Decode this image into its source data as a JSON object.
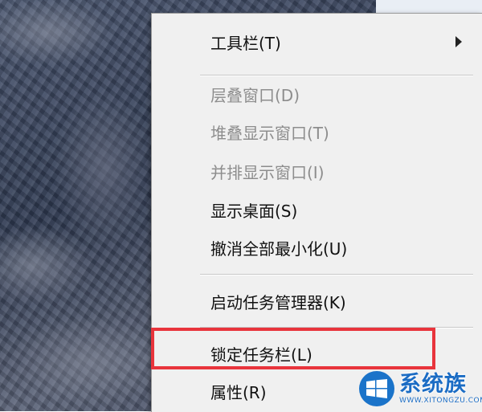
{
  "menu": {
    "items": [
      {
        "label": "工具栏(T)",
        "enabled": true,
        "submenu": true
      },
      {
        "label": "层叠窗口(D)",
        "enabled": false
      },
      {
        "label": "堆叠显示窗口(T)",
        "enabled": false
      },
      {
        "label": "并排显示窗口(I)",
        "enabled": false
      },
      {
        "label": "显示桌面(S)",
        "enabled": true
      },
      {
        "label": "撤消全部最小化(U)",
        "enabled": true
      },
      {
        "label": "启动任务管理器(K)",
        "enabled": true
      },
      {
        "label": "锁定任务栏(L)",
        "enabled": true,
        "highlighted": true
      },
      {
        "label": "属性(R)",
        "enabled": true
      }
    ]
  },
  "watermark": {
    "title": "系统族",
    "subtitle": "WWW.XITONGZU.COM"
  },
  "colors": {
    "menu_background": "#f0f0f0",
    "disabled_text": "#8d8d8d",
    "highlight_border": "#e8343c",
    "watermark_blue": "#1b6cc4"
  }
}
